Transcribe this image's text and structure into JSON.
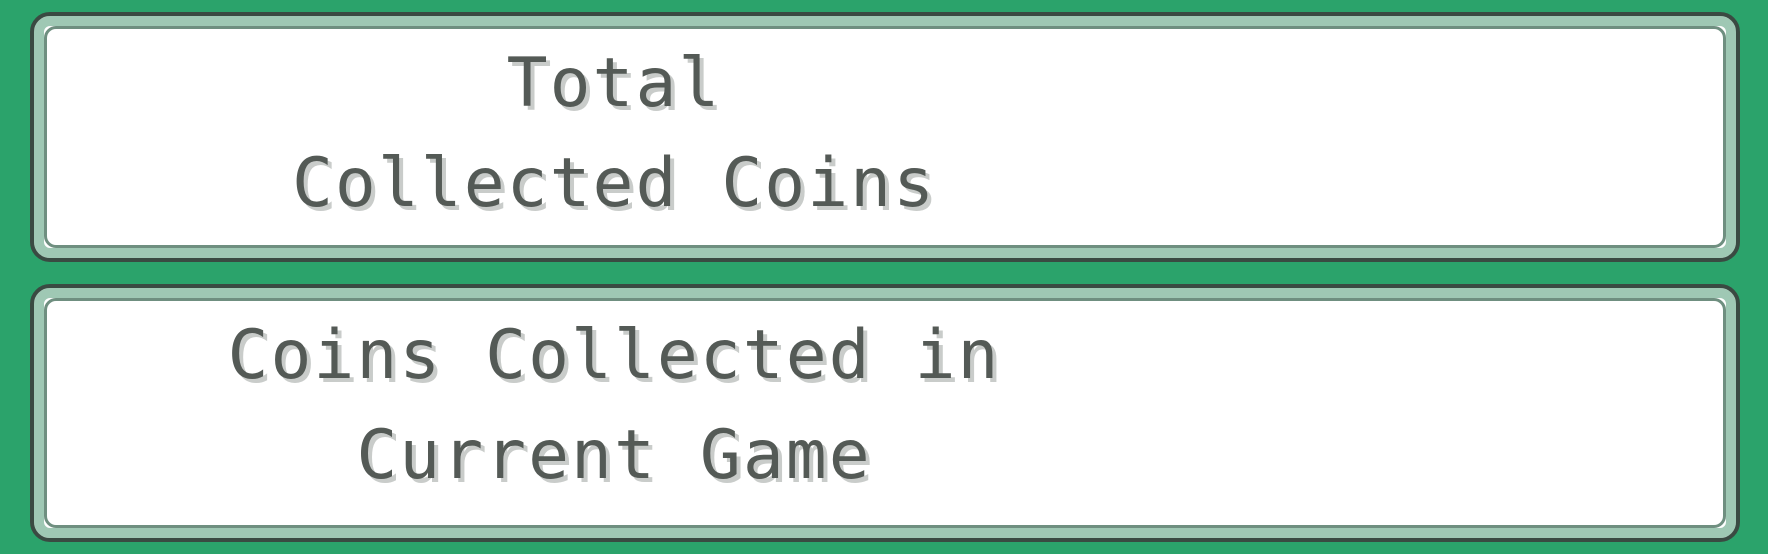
{
  "panels": {
    "total_coins": {
      "line1": "Total",
      "line2": "Collected Coins"
    },
    "current_game_coins": {
      "line1": "Coins Collected in",
      "line2": "Current Game"
    }
  },
  "colors": {
    "background": "#2ba36b",
    "panel_fill": "#ffffff",
    "panel_border": "#3a4a42",
    "panel_inner_border": "#9fc8b4",
    "text": "#545a56",
    "text_shadow": "#c9ccca"
  }
}
